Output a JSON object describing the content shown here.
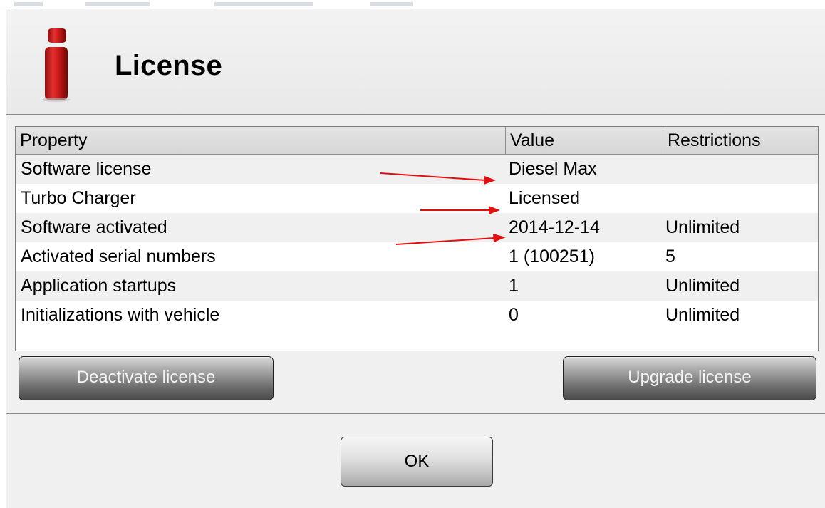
{
  "dialog": {
    "title": "License",
    "icon": "info-icon",
    "accent_color": "#d41c1c"
  },
  "table": {
    "headers": [
      "Property",
      "Value",
      "Restrictions"
    ],
    "rows": [
      {
        "property": "Software license",
        "value": "Diesel Max",
        "restriction": "",
        "arrow": true
      },
      {
        "property": "Turbo Charger",
        "value": "Licensed",
        "restriction": "",
        "arrow": true
      },
      {
        "property": "Software activated",
        "value": "2014-12-14",
        "restriction": "Unlimited",
        "arrow": true
      },
      {
        "property": "Activated serial numbers",
        "value": "1 (100251)",
        "restriction": "5",
        "arrow": false
      },
      {
        "property": "Application startups",
        "value": "1",
        "restriction": "Unlimited",
        "arrow": false
      },
      {
        "property": "Initializations with vehicle",
        "value": "0",
        "restriction": "Unlimited",
        "arrow": false
      }
    ]
  },
  "buttons": {
    "deactivate": "Deactivate license",
    "upgrade": "Upgrade license",
    "ok": "OK"
  },
  "annotation": {
    "arrow_color": "#e01010"
  }
}
